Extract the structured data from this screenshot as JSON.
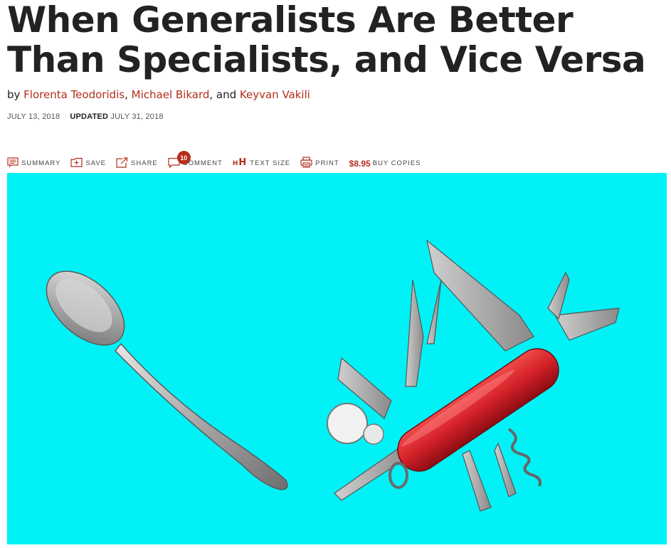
{
  "article": {
    "title": "When Generalists Are Better Than Specialists, and Vice Versa",
    "byline": {
      "prefix": "by ",
      "authors": [
        "Florenta Teodoridis",
        "Michael Bikard",
        "Keyvan Vakili"
      ],
      "sep1": ", ",
      "sep2": ", and "
    },
    "dates": {
      "published": "JULY 13, 2018",
      "updated_label": "UPDATED",
      "updated": "JULY 31, 2018"
    }
  },
  "toolbar": {
    "summary": "SUMMARY",
    "save": "SAVE",
    "share": "SHARE",
    "comment": "COMMENT",
    "comment_count": "10",
    "text_size_icon_small": "H",
    "text_size_icon_big": "H",
    "text_size": "TEXT SIZE",
    "print": "PRINT",
    "price": "$8.95",
    "buy": "BUY COPIES"
  },
  "colors": {
    "accent": "#b52d1b",
    "hero_bg": "#00f1f6",
    "knife_red": "#d42028"
  },
  "hero": {
    "icon_names": [
      "spoon-illustration",
      "swiss-army-knife-illustration"
    ]
  }
}
